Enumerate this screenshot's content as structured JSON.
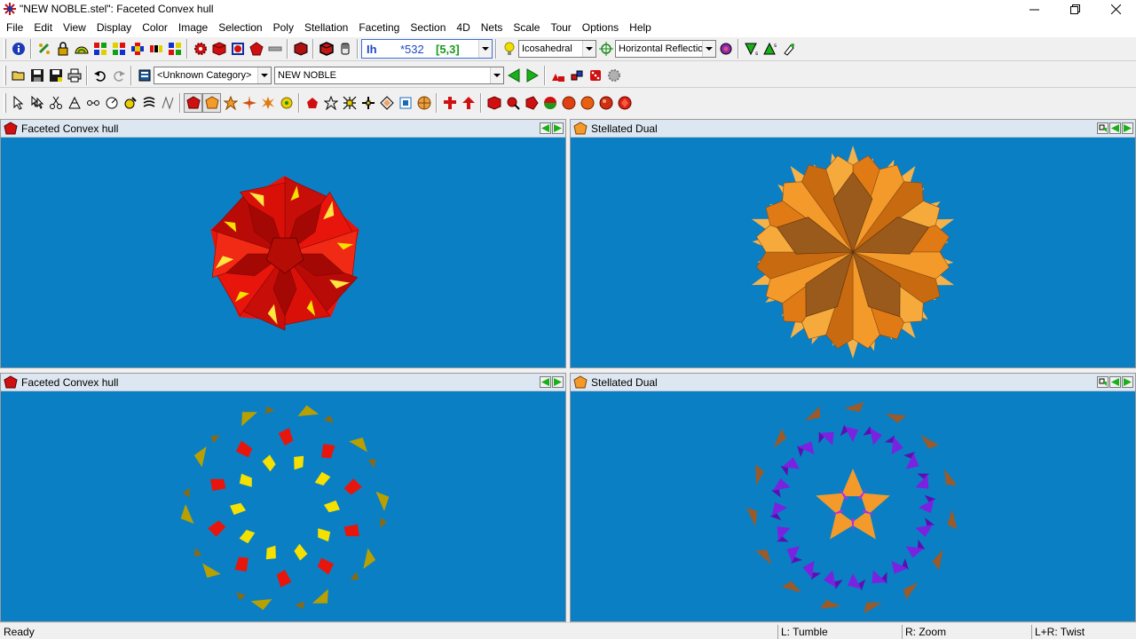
{
  "window": {
    "title": "\"NEW NOBLE.stel\": Faceted Convex hull",
    "icon": "star-burst-icon"
  },
  "menu": {
    "items": [
      "File",
      "Edit",
      "View",
      "Display",
      "Color",
      "Image",
      "Selection",
      "Poly",
      "Stellation",
      "Faceting",
      "Section",
      "4D",
      "Nets",
      "Scale",
      "Tour",
      "Options",
      "Help"
    ]
  },
  "toolbar1": {
    "symmetry_group": "Ih",
    "symmetry_order": "*532",
    "symmetry_schlafli": "[5,3]",
    "symmetry_family": "Icosahedral",
    "reflection_mode": "Horizontal Reflection"
  },
  "toolbar2": {
    "category": "<Unknown Category>",
    "model_name": "NEW NOBLE"
  },
  "panels": [
    {
      "title": "Faceted Convex hull",
      "nav_icons": [
        "arrow-left-icon",
        "arrow-right-icon"
      ]
    },
    {
      "title": "Stellated Dual",
      "nav_icons": [
        "swap-icon",
        "arrow-left-icon",
        "arrow-right-icon"
      ]
    },
    {
      "title": "Faceted Convex hull",
      "nav_icons": [
        "arrow-left-icon",
        "arrow-right-icon"
      ]
    },
    {
      "title": "Stellated Dual",
      "nav_icons": [
        "swap-icon",
        "arrow-left-icon",
        "arrow-right-icon"
      ]
    }
  ],
  "colors": {
    "viewport_bg": "#0a7fc4",
    "faceted_red": "#e8150c",
    "facet_yellow": "#f5e000",
    "dual_orange": "#f39a2a",
    "dual_purple": "#7a22e0",
    "dual_brown": "#9a5a2a"
  },
  "status": {
    "ready": "Ready",
    "left_button": "L: Tumble",
    "right_button": "R: Zoom",
    "both_buttons": "L+R: Twist"
  }
}
